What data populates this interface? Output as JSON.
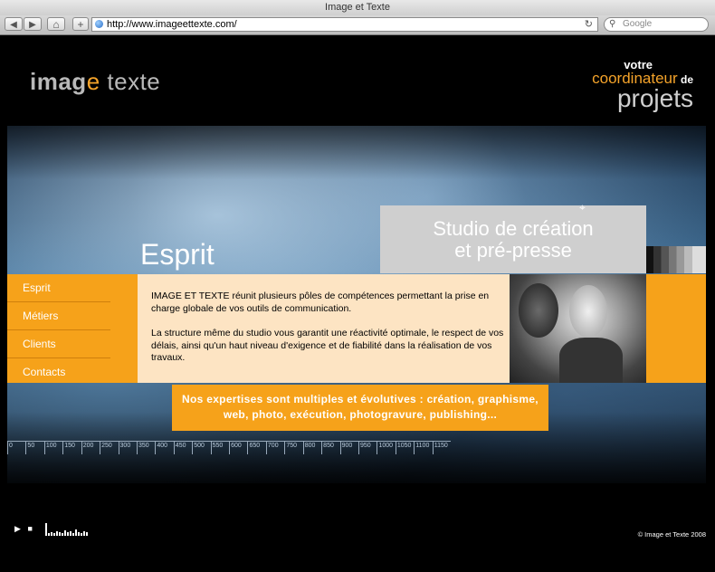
{
  "window": {
    "title": "Image et Texte"
  },
  "toolbar": {
    "back_label": "◀",
    "forward_label": "▶",
    "home_label": "⌂",
    "add_label": "+",
    "url": "http://www.imageettexte.com/",
    "reload_label": "↻",
    "search_placeholder": "Google",
    "search_icon_label": "⚲"
  },
  "logo": {
    "part1": "imag",
    "part2": "e",
    "part3": " texte"
  },
  "tagline": {
    "line1": "votre",
    "line2": "coordinateur",
    "line2b": " de",
    "line3": "projets"
  },
  "studio": {
    "line1": "Studio de création",
    "line2": "et pré-presse"
  },
  "section_title": "Esprit",
  "menu": [
    {
      "label": "Esprit"
    },
    {
      "label": "Métiers"
    },
    {
      "label": "Clients"
    },
    {
      "label": "Contacts"
    }
  ],
  "content": {
    "paragraph1": "IMAGE ET TEXTE réunit plusieurs pôles de compétences permettant la prise en charge globale de vos outils de communication.",
    "paragraph2": "La structure même du studio vous garantit une réactivité optimale, le respect de vos délais, ainsi qu'un haut niveau d'exigence et de fiabilité dans la réalisation de vos travaux."
  },
  "expertise": {
    "line1": "Nos expertises sont multiples et évolutives : création, graphisme,",
    "line2": "web, photo, exécution, photogravure, publishing..."
  },
  "ruler": [
    "0",
    "50",
    "100",
    "150",
    "200",
    "250",
    "300",
    "350",
    "400",
    "450",
    "500",
    "550",
    "600",
    "650",
    "700",
    "750",
    "800",
    "850",
    "900",
    "950",
    "1000",
    "1050",
    "1100",
    "1150"
  ],
  "player": {
    "play_label": "▶",
    "stop_label": "■"
  },
  "copyright": "© Image et Texte 2008",
  "colors": {
    "accent": "#f6a21a",
    "panel": "#fde4c3",
    "studio_bg": "#cfcfcf"
  }
}
